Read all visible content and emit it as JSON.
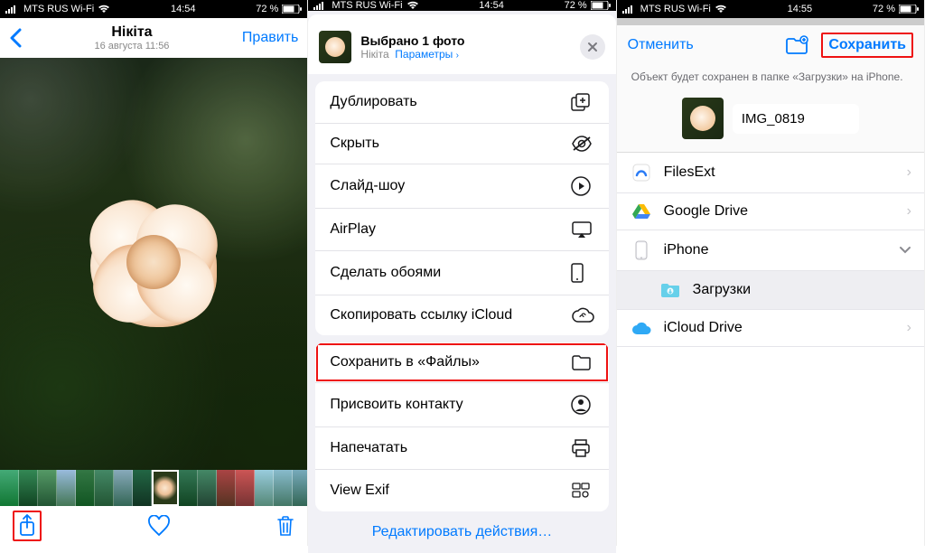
{
  "status": {
    "carrier": "MTS RUS Wi-Fi",
    "time1": "14:54",
    "time2": "14:54",
    "time3": "14:55",
    "battery": "72 %"
  },
  "screen1": {
    "title": "Нікіта",
    "subtitle": "16 августа  11:56",
    "edit": "Править"
  },
  "screen2": {
    "selected_title": "Выбрано 1 фото",
    "selected_subtitle_name": "Нікіта",
    "selected_subtitle_opt": "Параметры",
    "actions_group1": [
      "Дублировать",
      "Скрыть",
      "Слайд-шоу",
      "AirPlay",
      "Сделать обоями",
      "Скопировать ссылку iCloud"
    ],
    "actions_group2": [
      "Сохранить в «Файлы»",
      "Присвоить контакту",
      "Напечатать",
      "View Exif"
    ],
    "edit_actions": "Редактировать действия…"
  },
  "screen3": {
    "cancel": "Отменить",
    "save": "Сохранить",
    "info": "Объект будет сохранен в папке «Загрузки» на iPhone.",
    "filename": "IMG_0819",
    "locations": {
      "filesext": "FilesExt",
      "gdrive": "Google Drive",
      "iphone": "iPhone",
      "downloads": "Загрузки",
      "icloud": "iCloud Drive"
    }
  }
}
